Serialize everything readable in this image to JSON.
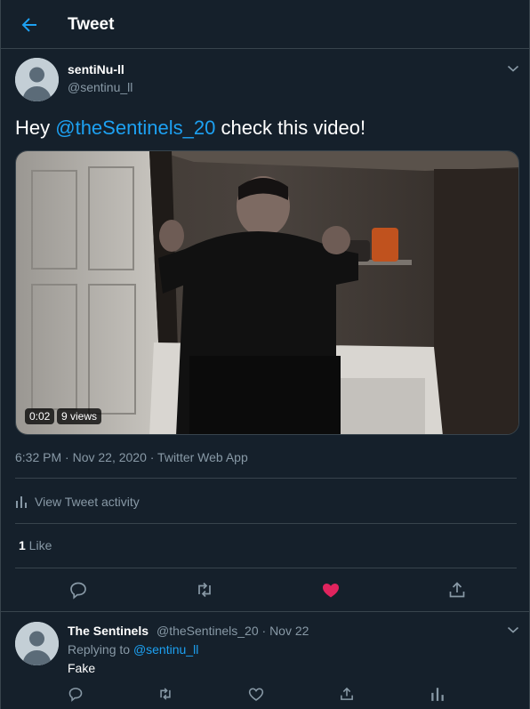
{
  "header": {
    "title": "Tweet",
    "back_icon": "arrow-left-icon"
  },
  "tweet": {
    "author_name": "sentiNu-ll",
    "author_handle": "@sentinu_ll",
    "text_prefix": "Hey ",
    "mention": "@theSentinels_20",
    "text_suffix": " check this video!",
    "video": {
      "duration": "0:02",
      "views": "9 views"
    },
    "meta": "6:32 PM · Nov 22, 2020 · Twitter Web App",
    "activity_label": "View Tweet activity",
    "likes_count": "1",
    "likes_label": " Like",
    "actions": [
      "reply-icon",
      "retweet-icon",
      "like-icon-filled",
      "share-icon"
    ]
  },
  "reply": {
    "author_name": "The Sentinels",
    "author_handle": "@theSentinels_20 · Nov 22",
    "replying_prefix": "Replying to ",
    "replying_to": "@sentinu_ll",
    "text": "Fake",
    "actions": [
      "reply-icon",
      "retweet-icon",
      "like-icon",
      "share-icon",
      "analytics-icon"
    ]
  },
  "colors": {
    "background": "#15202b",
    "border": "#38444d",
    "accent": "#1da1f2",
    "muted": "#8899a6",
    "like": "#e0245e"
  }
}
